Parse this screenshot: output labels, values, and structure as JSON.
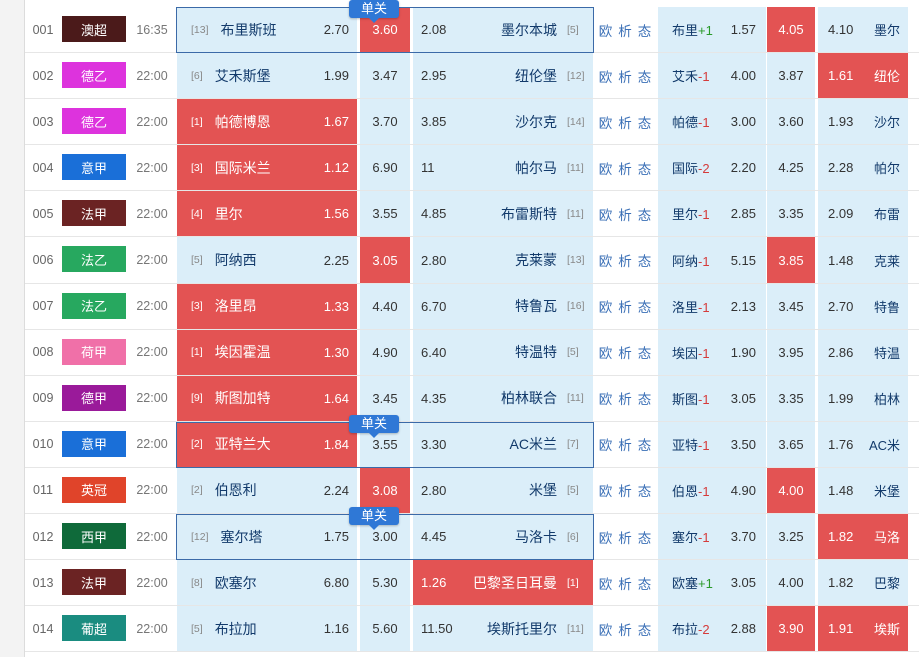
{
  "single_label": "单关",
  "links": [
    "欧",
    "析",
    "态"
  ],
  "matches": [
    {
      "num": "001",
      "league": "澳超",
      "league_color": "#4b1a1a",
      "time": "16:35",
      "home_rank": "[13]",
      "home": "布里斯班",
      "home_odd": "2.70",
      "draw": "3.60",
      "away_odd": "2.08",
      "away": "墨尔本城",
      "away_rank": "[5]",
      "hcap_team": "布里",
      "hcap_sign": "+1",
      "hcap_odd": "1.57",
      "c2": "4.05",
      "c3": "4.10",
      "c3_abbr": "墨尔",
      "hot": [
        "draw",
        "c2"
      ],
      "single": true
    },
    {
      "num": "002",
      "league": "德乙",
      "league_color": "#dd33dd",
      "time": "22:00",
      "home_rank": "[6]",
      "home": "艾禾斯堡",
      "home_odd": "1.99",
      "draw": "3.47",
      "away_odd": "2.95",
      "away": "纽伦堡",
      "away_rank": "[12]",
      "hcap_team": "艾禾",
      "hcap_sign": "-1",
      "hcap_odd": "4.00",
      "c2": "3.87",
      "c3": "1.61",
      "c3_abbr": "纽伦",
      "hot": [
        "c3"
      ],
      "single": false
    },
    {
      "num": "003",
      "league": "德乙",
      "league_color": "#dd33dd",
      "time": "22:00",
      "home_rank": "[1]",
      "home": "帕德博恩",
      "home_odd": "1.67",
      "draw": "3.70",
      "away_odd": "3.85",
      "away": "沙尔克",
      "away_rank": "[14]",
      "hcap_team": "帕德",
      "hcap_sign": "-1",
      "hcap_odd": "3.00",
      "c2": "3.60",
      "c3": "1.93",
      "c3_abbr": "沙尔",
      "hot": [
        "home"
      ],
      "single": false
    },
    {
      "num": "004",
      "league": "意甲",
      "league_color": "#1a6fd8",
      "time": "22:00",
      "home_rank": "[3]",
      "home": "国际米兰",
      "home_odd": "1.12",
      "draw": "6.90",
      "away_odd": "11",
      "away": "帕尔马",
      "away_rank": "[11]",
      "hcap_team": "国际",
      "hcap_sign": "-2",
      "hcap_odd": "2.20",
      "c2": "4.25",
      "c3": "2.28",
      "c3_abbr": "帕尔",
      "hot": [
        "home"
      ],
      "single": false
    },
    {
      "num": "005",
      "league": "法甲",
      "league_color": "#6b2323",
      "time": "22:00",
      "home_rank": "[4]",
      "home": "里尔",
      "home_odd": "1.56",
      "draw": "3.55",
      "away_odd": "4.85",
      "away": "布雷斯特",
      "away_rank": "[11]",
      "hcap_team": "里尔",
      "hcap_sign": "-1",
      "hcap_odd": "2.85",
      "c2": "3.35",
      "c3": "2.09",
      "c3_abbr": "布雷",
      "hot": [
        "home"
      ],
      "single": false
    },
    {
      "num": "006",
      "league": "法乙",
      "league_color": "#27a85f",
      "time": "22:00",
      "home_rank": "[5]",
      "home": "阿纳西",
      "home_odd": "2.25",
      "draw": "3.05",
      "away_odd": "2.80",
      "away": "克莱蒙",
      "away_rank": "[13]",
      "hcap_team": "阿纳",
      "hcap_sign": "-1",
      "hcap_odd": "5.15",
      "c2": "3.85",
      "c3": "1.48",
      "c3_abbr": "克莱",
      "hot": [
        "draw",
        "c2"
      ],
      "single": false
    },
    {
      "num": "007",
      "league": "法乙",
      "league_color": "#27a85f",
      "time": "22:00",
      "home_rank": "[3]",
      "home": "洛里昂",
      "home_odd": "1.33",
      "draw": "4.40",
      "away_odd": "6.70",
      "away": "特鲁瓦",
      "away_rank": "[16]",
      "hcap_team": "洛里",
      "hcap_sign": "-1",
      "hcap_odd": "2.13",
      "c2": "3.45",
      "c3": "2.70",
      "c3_abbr": "特鲁",
      "hot": [
        "home"
      ],
      "single": false
    },
    {
      "num": "008",
      "league": "荷甲",
      "league_color": "#f070a8",
      "time": "22:00",
      "home_rank": "[1]",
      "home": "埃因霍温",
      "home_odd": "1.30",
      "draw": "4.90",
      "away_odd": "6.40",
      "away": "特温特",
      "away_rank": "[5]",
      "hcap_team": "埃因",
      "hcap_sign": "-1",
      "hcap_odd": "1.90",
      "c2": "3.95",
      "c3": "2.86",
      "c3_abbr": "特温",
      "hot": [
        "home"
      ],
      "single": false
    },
    {
      "num": "009",
      "league": "德甲",
      "league_color": "#9a1a9a",
      "time": "22:00",
      "home_rank": "[9]",
      "home": "斯图加特",
      "home_odd": "1.64",
      "draw": "3.45",
      "away_odd": "4.35",
      "away": "柏林联合",
      "away_rank": "[11]",
      "hcap_team": "斯图",
      "hcap_sign": "-1",
      "hcap_odd": "3.05",
      "c2": "3.35",
      "c3": "1.99",
      "c3_abbr": "柏林",
      "hot": [
        "home"
      ],
      "single": false
    },
    {
      "num": "010",
      "league": "意甲",
      "league_color": "#1a6fd8",
      "time": "22:00",
      "home_rank": "[2]",
      "home": "亚特兰大",
      "home_odd": "1.84",
      "draw": "3.55",
      "away_odd": "3.30",
      "away": "AC米兰",
      "away_rank": "[7]",
      "hcap_team": "亚特",
      "hcap_sign": "-1",
      "hcap_odd": "3.50",
      "c2": "3.65",
      "c3": "1.76",
      "c3_abbr": "AC米",
      "hot": [
        "home"
      ],
      "single": true
    },
    {
      "num": "011",
      "league": "英冠",
      "league_color": "#e0442a",
      "time": "22:00",
      "home_rank": "[2]",
      "home": "伯恩利",
      "home_odd": "2.24",
      "draw": "3.08",
      "away_odd": "2.80",
      "away": "米堡",
      "away_rank": "[5]",
      "hcap_team": "伯恩",
      "hcap_sign": "-1",
      "hcap_odd": "4.90",
      "c2": "4.00",
      "c3": "1.48",
      "c3_abbr": "米堡",
      "hot": [
        "draw",
        "c2"
      ],
      "single": false
    },
    {
      "num": "012",
      "league": "西甲",
      "league_color": "#0f6a3a",
      "time": "22:00",
      "home_rank": "[12]",
      "home": "塞尔塔",
      "home_odd": "1.75",
      "draw": "3.00",
      "away_odd": "4.45",
      "away": "马洛卡",
      "away_rank": "[6]",
      "hcap_team": "塞尔",
      "hcap_sign": "-1",
      "hcap_odd": "3.70",
      "c2": "3.25",
      "c3": "1.82",
      "c3_abbr": "马洛",
      "hot": [
        "c3"
      ],
      "single": true
    },
    {
      "num": "013",
      "league": "法甲",
      "league_color": "#6b2323",
      "time": "22:00",
      "home_rank": "[8]",
      "home": "欧塞尔",
      "home_odd": "6.80",
      "draw": "5.30",
      "away_odd": "1.26",
      "away": "巴黎圣日耳曼",
      "away_rank": "[1]",
      "hcap_team": "欧塞",
      "hcap_sign": "+1",
      "hcap_odd": "3.05",
      "c2": "4.00",
      "c3": "1.82",
      "c3_abbr": "巴黎",
      "hot": [
        "away"
      ],
      "single": false
    },
    {
      "num": "014",
      "league": "葡超",
      "league_color": "#1a8c80",
      "time": "22:00",
      "home_rank": "[5]",
      "home": "布拉加",
      "home_odd": "1.16",
      "draw": "5.60",
      "away_odd": "11.50",
      "away": "埃斯托里尔",
      "away_rank": "[11]",
      "hcap_team": "布拉",
      "hcap_sign": "-2",
      "hcap_odd": "2.88",
      "c2": "3.90",
      "c3": "1.91",
      "c3_abbr": "埃斯",
      "hot": [
        "c2",
        "c3"
      ],
      "single": false
    }
  ]
}
